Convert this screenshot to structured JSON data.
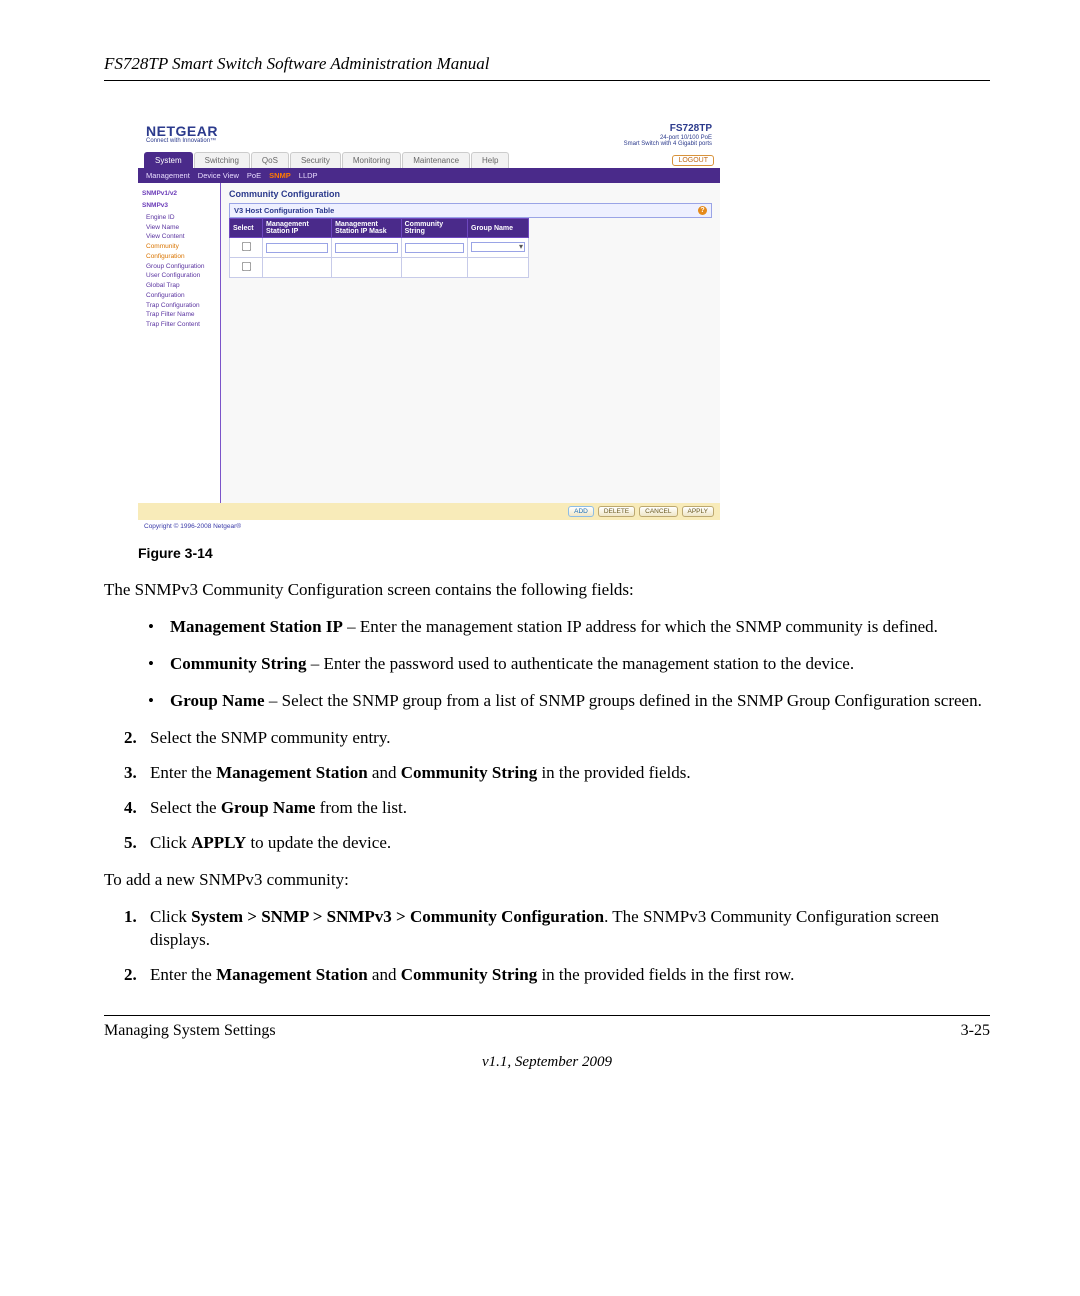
{
  "running_head": "FS728TP Smart Switch Software Administration Manual",
  "figure": {
    "logo": "NETGEAR",
    "tagline": "Connect with Innovation™",
    "model": {
      "name": "FS728TP",
      "line1": "24-port 10/100 PoE",
      "line2": "Smart Switch with 4 Gigabit ports"
    },
    "tabs": [
      "System",
      "Switching",
      "QoS",
      "Security",
      "Monitoring",
      "Maintenance",
      "Help"
    ],
    "tabs_active": 0,
    "logout": "LOGOUT",
    "subtabs": [
      "Management",
      "Device View",
      "PoE",
      "SNMP",
      "LLDP"
    ],
    "subtabs_active": 3,
    "side": {
      "group1": "SNMPv1/v2",
      "group2": "SNMPv3",
      "items": [
        "Engine ID",
        "View Name",
        "View Content",
        "Community Configuration",
        "Group Configuration",
        "User Configuration",
        "Global Trap Configuration",
        "Trap Configuration",
        "Trap Filter Name",
        "Trap Filter Content"
      ],
      "active_index": 3
    },
    "panel_title": "Community Configuration",
    "table_caption": "V3 Host Configuration Table",
    "columns": [
      "Select",
      "Management Station IP",
      "Management Station IP Mask",
      "Community String",
      "Group Name"
    ],
    "buttons": [
      "ADD",
      "DELETE",
      "CANCEL",
      "APPLY"
    ],
    "copyright": "Copyright © 1996-2008 Netgear®"
  },
  "caption": "Figure 3-14",
  "intro": "The SNMPv3 Community Configuration screen contains the following fields:",
  "bullets": [
    {
      "term": "Management Station IP",
      "desc": " – Enter the management station IP address for which the SNMP community is defined."
    },
    {
      "term": "Community String",
      "desc": " – Enter the password used to authenticate the management station to the device."
    },
    {
      "term": "Group Name",
      "desc": " – Select the SNMP group from a list of SNMP groups defined in the SNMP Group Configuration screen."
    }
  ],
  "steps_a": [
    {
      "n": "2.",
      "pre": "Select the SNMP community entry."
    },
    {
      "n": "3.",
      "pre": "Enter the ",
      "b1": "Management Station",
      "mid": " and ",
      "b2": "Community String",
      "post": " in the provided fields."
    },
    {
      "n": "4.",
      "pre": "Select the ",
      "b1": "Group Name",
      "post": " from the list."
    },
    {
      "n": "5.",
      "pre": "Click ",
      "b1": "APPLY",
      "post": " to update the device."
    }
  ],
  "add_intro": "To add a new SNMPv3 community:",
  "steps_b": [
    {
      "n": "1.",
      "pre": "Click ",
      "b1": "System > SNMP > SNMPv3 > Community Configuration",
      "post": ". The SNMPv3 Community Configuration screen displays."
    },
    {
      "n": "2.",
      "pre": "Enter the ",
      "b1": "Management Station",
      "mid": " and ",
      "b2": "Community String",
      "post": " in the provided fields in the first row."
    }
  ],
  "footer": {
    "left": "Managing System Settings",
    "right": "3-25",
    "center": "v1.1, September 2009"
  }
}
